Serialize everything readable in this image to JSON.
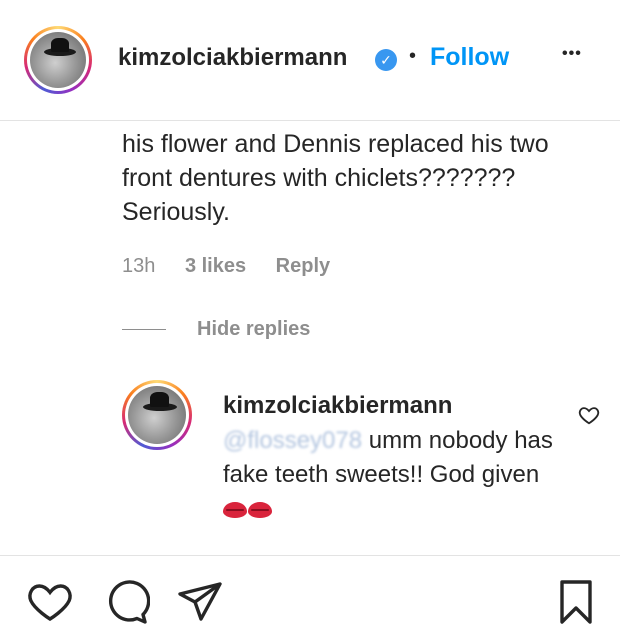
{
  "header": {
    "username": "kimzolciakbiermann",
    "verified_mark": "✓",
    "separator": "•",
    "follow_label": "Follow",
    "more_label": "•••"
  },
  "comment": {
    "text": "his flower and Dennis replaced his two front dentures with chiclets??????? Seriously.",
    "time": "13h",
    "likes": "3 likes",
    "reply_label": "Reply"
  },
  "hide_replies_label": "Hide replies",
  "reply": {
    "username": "kimzolciakbiermann",
    "mention": "@flossey078",
    "text_line1": "umm nobody",
    "text_rest": "has fake teeth sweets!! God given",
    "emoji": "kiss-mark-emoji"
  },
  "actions": {
    "icons": [
      "heart-icon",
      "comment-icon",
      "share-icon",
      "bookmark-icon"
    ]
  },
  "colors": {
    "accent": "#0095f6",
    "muted": "#8e8e8e",
    "text": "#262626"
  }
}
